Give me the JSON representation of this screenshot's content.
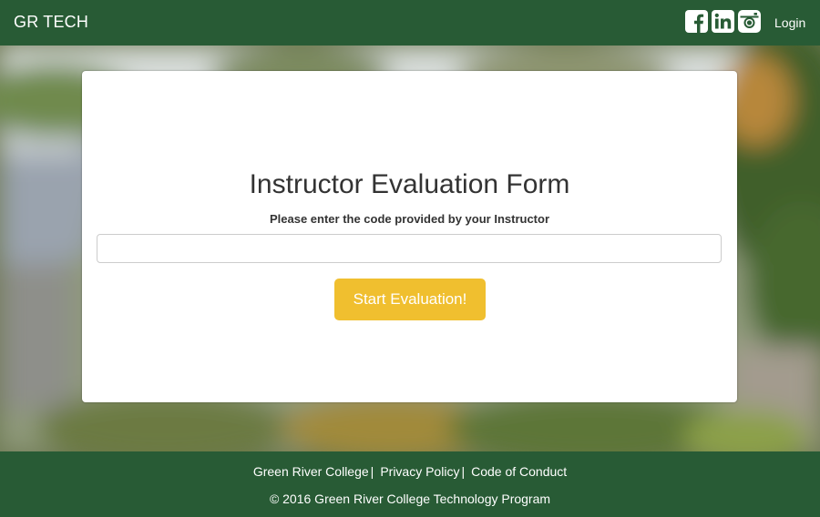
{
  "header": {
    "brand": "GR TECH",
    "login_label": "Login",
    "social_icons": [
      "facebook-icon",
      "linkedin-icon",
      "instagram-icon"
    ]
  },
  "form": {
    "title": "Instructor Evaluation Form",
    "hint": "Please enter the code provided by your Instructor",
    "code_value": "",
    "code_placeholder": "",
    "submit_label": "Start Evaluation!"
  },
  "footer": {
    "links": [
      "Green River College",
      "Privacy Policy",
      "Code of Conduct"
    ],
    "separator": "|",
    "copyright": "© 2016 Green River College Technology Program"
  },
  "colors": {
    "nav_green": "#285b35",
    "button_yellow": "#f0bf2f",
    "card_bg": "#ffffff"
  }
}
